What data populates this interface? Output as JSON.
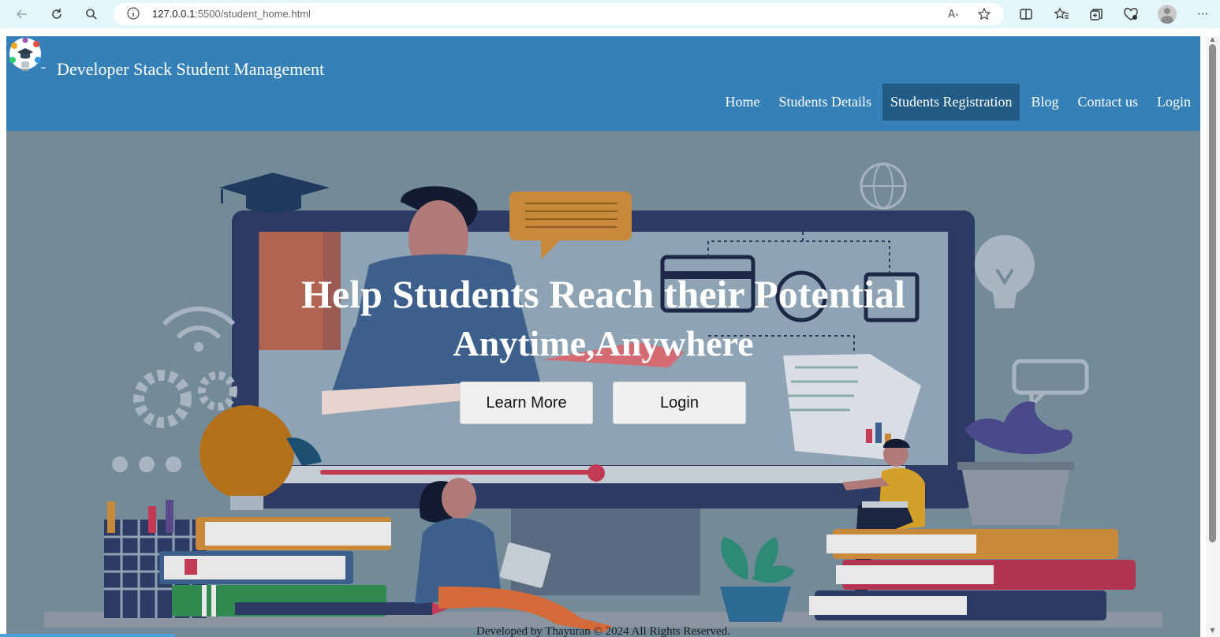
{
  "browser": {
    "url_host": "127.0.0.1",
    "url_path": ":5500/student_home.html",
    "icons": [
      "back-icon",
      "refresh-icon",
      "search-icon",
      "site-info-icon",
      "read-aloud-icon",
      "favorite-star-icon",
      "split-screen-icon",
      "favorites-icon",
      "collections-icon",
      "performance-icon",
      "profile-avatar",
      "more-icon"
    ]
  },
  "header": {
    "brand": "Developer Stack Student Management",
    "nav": [
      {
        "label": "Home"
      },
      {
        "label": "Students Details"
      },
      {
        "label": "Students Registration",
        "active": true
      },
      {
        "label": "Blog"
      },
      {
        "label": "Contact us"
      },
      {
        "label": "Login"
      }
    ]
  },
  "hero": {
    "title_line1": "Help Students Reach their Potential",
    "title_line2": "Anytime,Anywhere",
    "learn_more": "Learn More",
    "login": "Login"
  },
  "footer": {
    "text": "Developed by Thayuran © 2024 All Rights Reserved."
  },
  "colors": {
    "header_bg": "#3580b7",
    "active_nav": "#215b86",
    "browser_bar": "#e3f7f8",
    "hero_overlay": "#738b99"
  }
}
